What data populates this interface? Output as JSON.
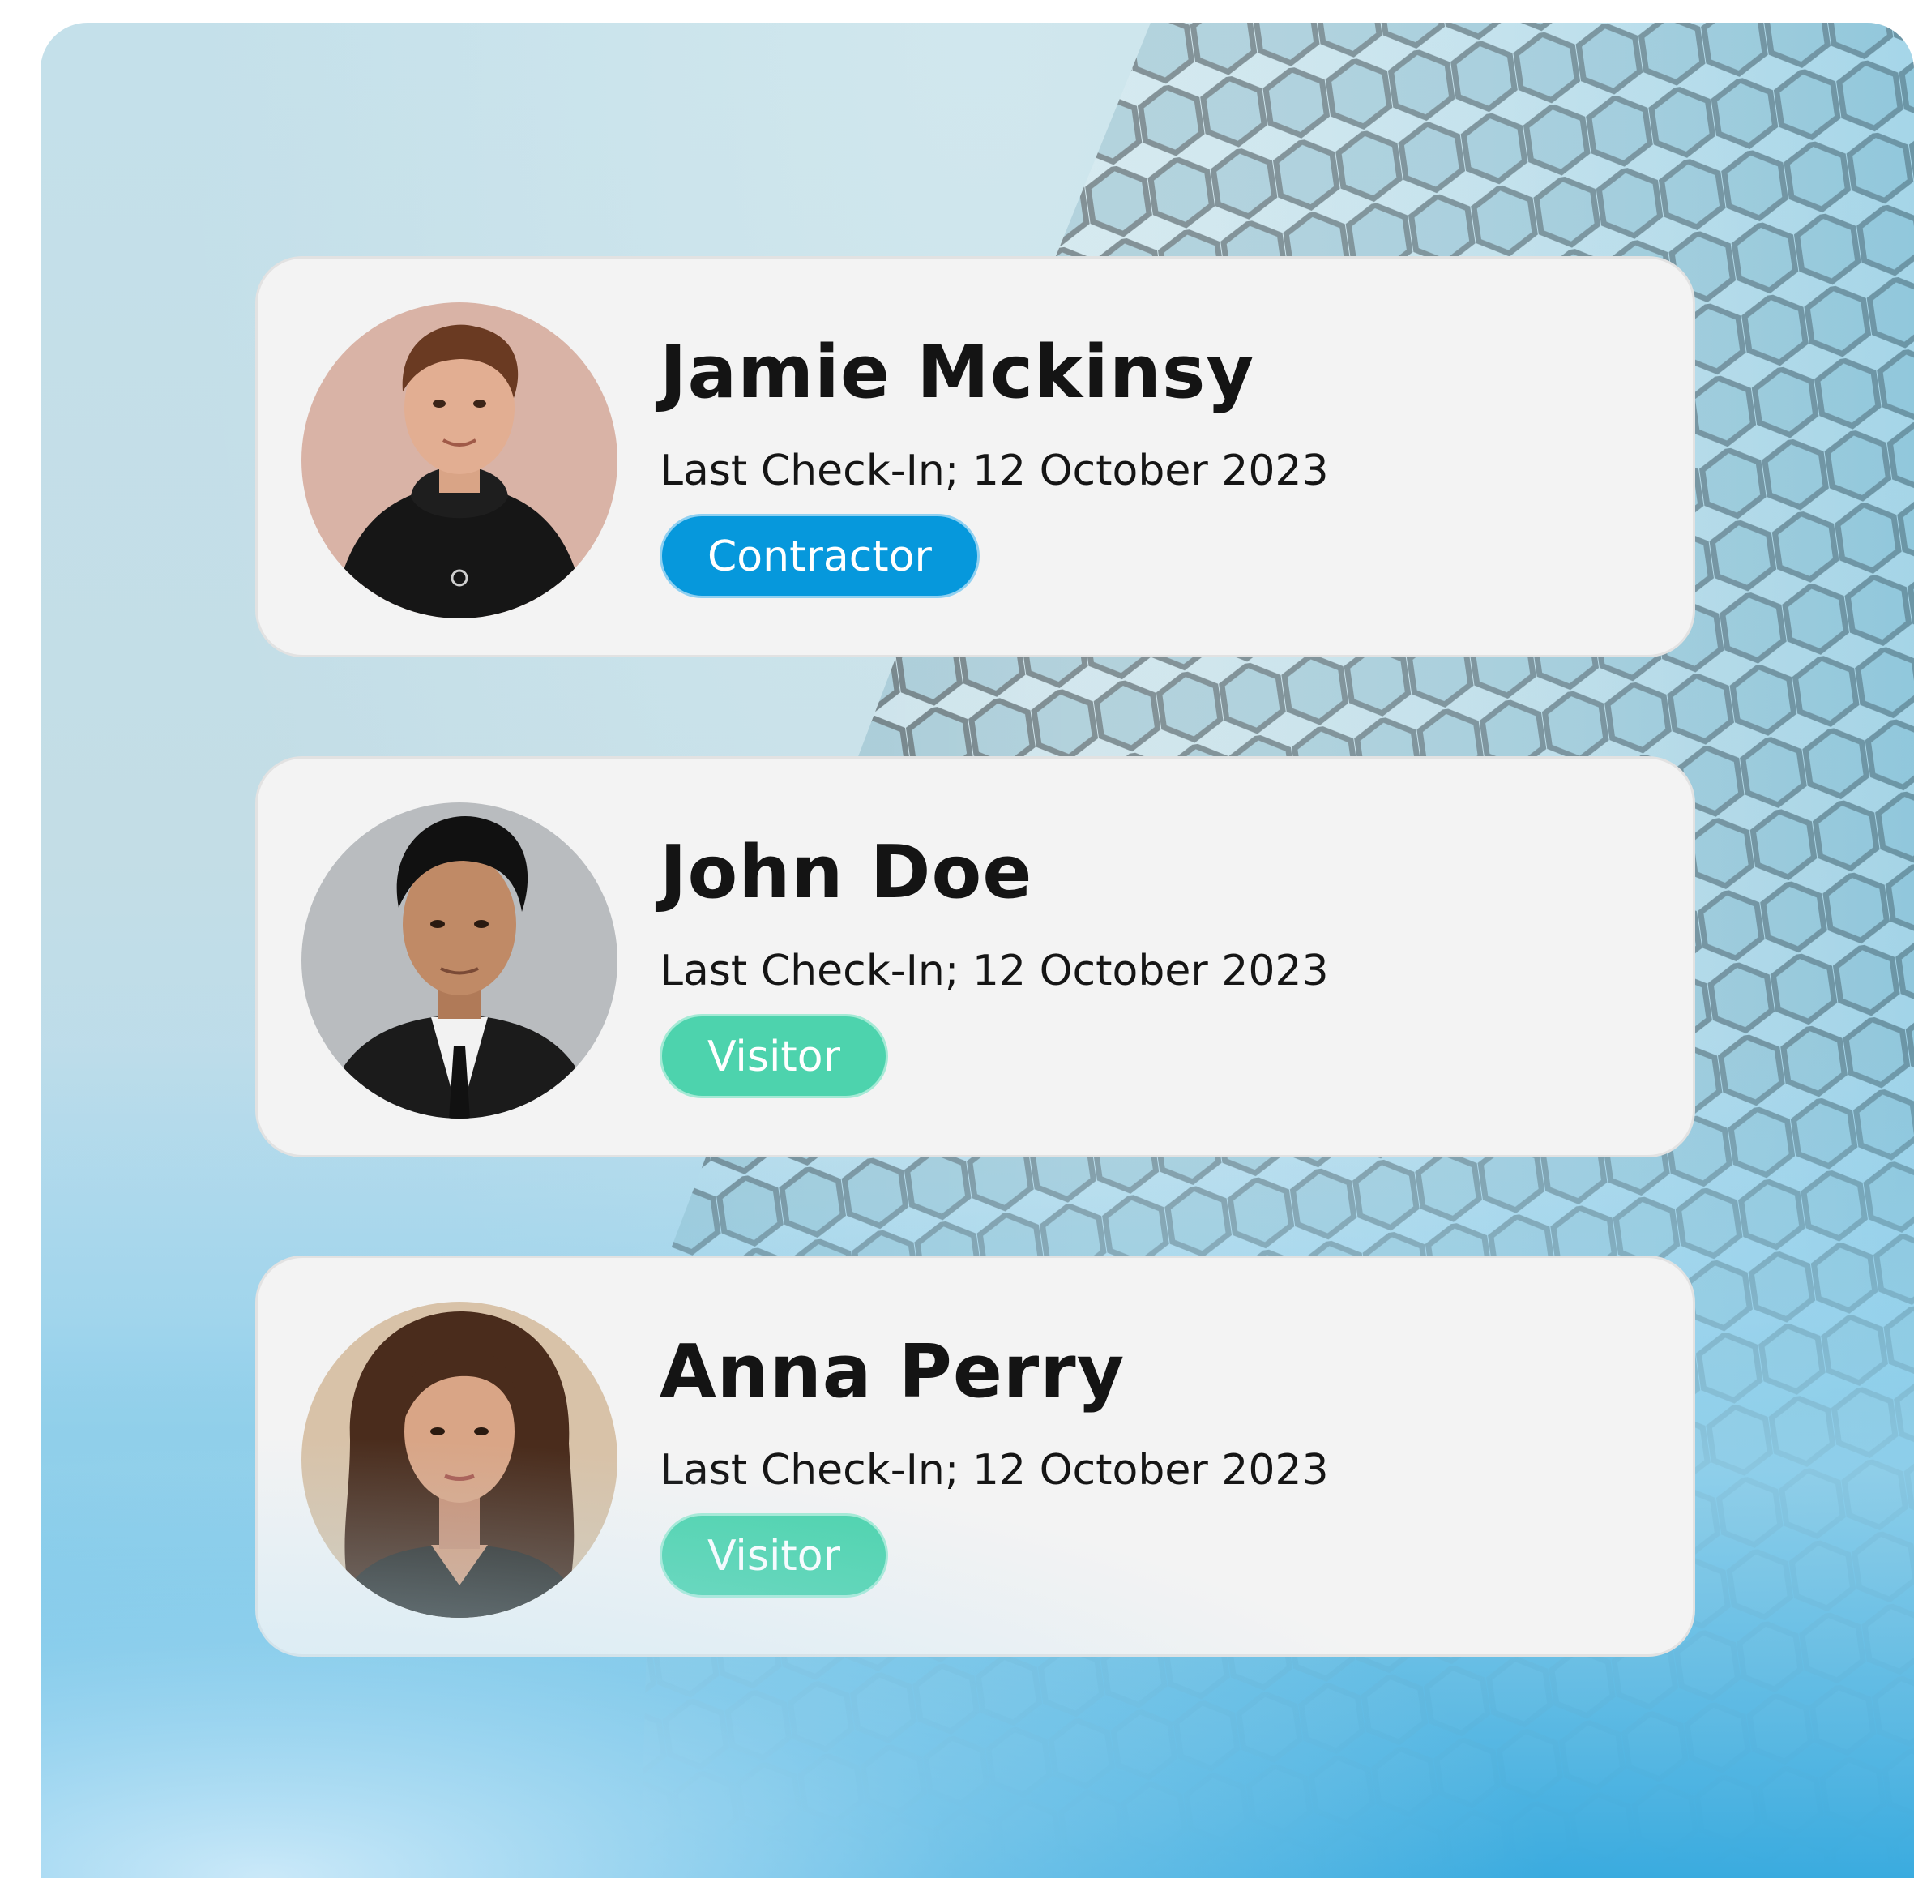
{
  "people": [
    {
      "name": "Jamie Mckinsy",
      "checkin": "Last Check-In; 12 October 2023",
      "role": "Contractor",
      "role_color": "#0698dc"
    },
    {
      "name": "John Doe",
      "checkin": "Last Check-In; 12 October 2023",
      "role": "Visitor",
      "role_color": "#4dd3ad"
    },
    {
      "name": "Anna Perry",
      "checkin": "Last Check-In; 12 October 2023",
      "role": "Visitor",
      "role_color": "#4dd3ad"
    }
  ]
}
